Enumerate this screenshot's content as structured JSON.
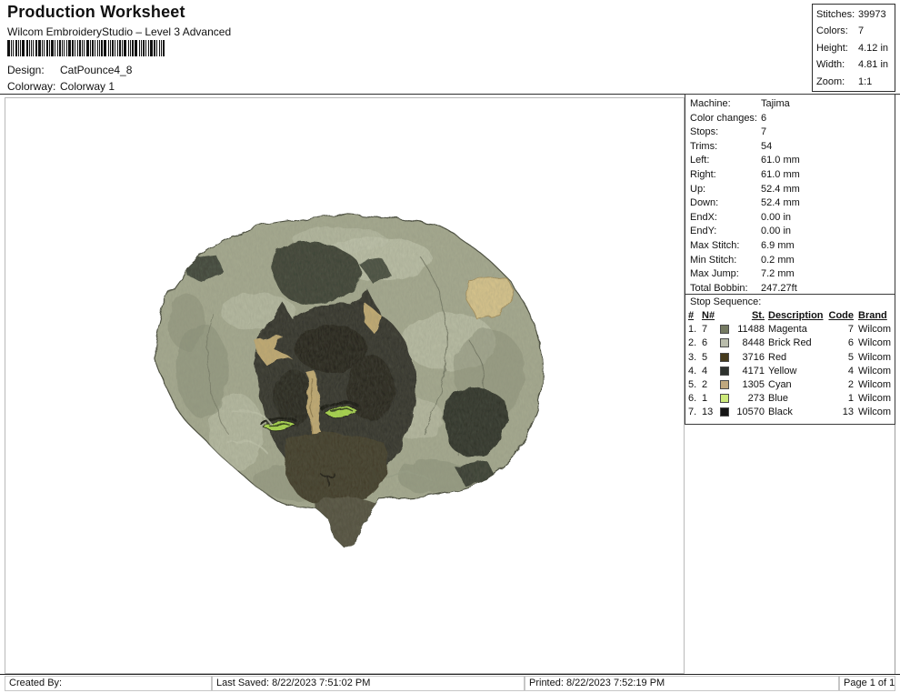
{
  "header": {
    "title": "Production Worksheet",
    "subtitle": "Wilcom EmbroideryStudio – Level 3 Advanced",
    "design_label": "Design:",
    "design_value": "CatPounce4_8",
    "colorway_label": "Colorway:",
    "colorway_value": "Colorway 1"
  },
  "summary": {
    "rows": [
      {
        "label": "Stitches:",
        "value": "39973"
      },
      {
        "label": "Colors:",
        "value": "7"
      },
      {
        "label": "Height:",
        "value": "4.12 in"
      },
      {
        "label": "Width:",
        "value": "4.81 in"
      },
      {
        "label": "Zoom:",
        "value": "1:1"
      }
    ]
  },
  "machine_info": {
    "rows": [
      {
        "label": "Machine:",
        "value": "Tajima"
      },
      {
        "label": "Color changes:",
        "value": "6"
      },
      {
        "label": "Stops:",
        "value": "7"
      },
      {
        "label": "Trims:",
        "value": "54"
      },
      {
        "label": "Left:",
        "value": "61.0 mm"
      },
      {
        "label": "Right:",
        "value": "61.0 mm"
      },
      {
        "label": "Up:",
        "value": "52.4 mm"
      },
      {
        "label": "Down:",
        "value": "52.4 mm"
      },
      {
        "label": "EndX:",
        "value": "0.00 in"
      },
      {
        "label": "EndY:",
        "value": "0.00 in"
      },
      {
        "label": "Max Stitch:",
        "value": "6.9 mm"
      },
      {
        "label": "Min Stitch:",
        "value": "0.2 mm"
      },
      {
        "label": "Max Jump:",
        "value": "7.2 mm"
      },
      {
        "label": "Total Bobbin:",
        "value": "247.27ft"
      }
    ]
  },
  "stop_sequence": {
    "title": "Stop Sequence:",
    "columns": {
      "num": "#",
      "needle": "N#",
      "stitches": "St.",
      "description": "Description",
      "code": "Code",
      "brand": "Brand"
    },
    "rows": [
      {
        "num": "1.",
        "needle": "7",
        "swatch": "#757a62",
        "st": "11488",
        "description": "Magenta",
        "code": "7",
        "brand": "Wilcom"
      },
      {
        "num": "2.",
        "needle": "6",
        "swatch": "#b9bcab",
        "st": "8448",
        "description": "Brick Red",
        "code": "6",
        "brand": "Wilcom"
      },
      {
        "num": "3.",
        "needle": "5",
        "swatch": "#453a1c",
        "st": "3716",
        "description": "Red",
        "code": "5",
        "brand": "Wilcom"
      },
      {
        "num": "4.",
        "needle": "4",
        "swatch": "#2e322e",
        "st": "4171",
        "description": "Yellow",
        "code": "4",
        "brand": "Wilcom"
      },
      {
        "num": "5.",
        "needle": "2",
        "swatch": "#c0a87e",
        "st": "1305",
        "description": "Cyan",
        "code": "2",
        "brand": "Wilcom"
      },
      {
        "num": "6.",
        "needle": "1",
        "swatch": "#cdea7a",
        "st": "273",
        "description": "Blue",
        "code": "1",
        "brand": "Wilcom"
      },
      {
        "num": "7.",
        "needle": "13",
        "swatch": "#141414",
        "st": "10570",
        "description": "Black",
        "code": "13",
        "brand": "Wilcom"
      }
    ]
  },
  "footer": {
    "created_by": "Created By:",
    "last_saved": "Last Saved: 8/22/2023 7:51:02 PM",
    "printed": "Printed: 8/22/2023 7:52:19 PM",
    "page": "Page 1 of 1"
  },
  "design_preview": {
    "palette": {
      "base": "#a6aa90",
      "light": "#c2c5ad",
      "shade": "#8b9078",
      "dark_patch": "#3c4134",
      "darker_patch": "#2e3228",
      "head": "#32322a",
      "head_dark": "#211f18",
      "tan": "#c3ab72",
      "tan_light": "#d9c58c",
      "eye_green": "#a9d94b",
      "muzzle": "#403b28",
      "tail": "#53503e",
      "outline": "#4b4e3f"
    }
  }
}
